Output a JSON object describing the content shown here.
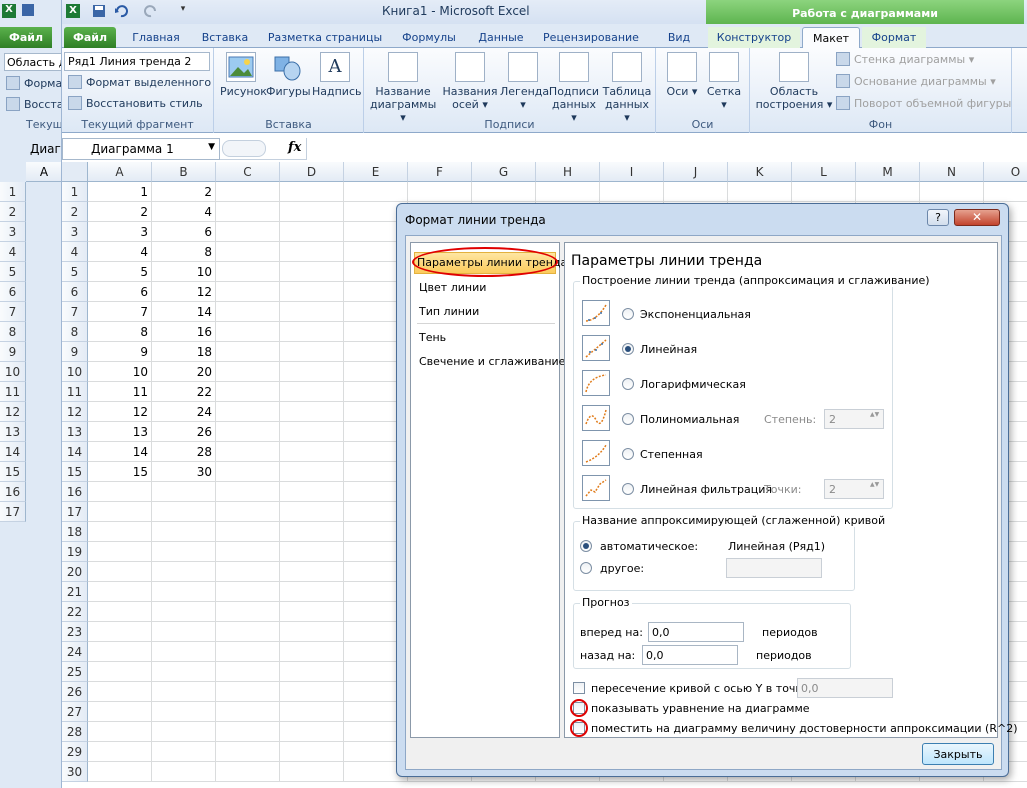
{
  "back_window": {
    "file_tab": "Файл",
    "namebox_frag": "Область д",
    "format_frag": "Форма",
    "restore_frag": "Восста",
    "current_frag": "Текущ",
    "namebox2_frag": "Диагр",
    "col_a": "A",
    "rows": [
      "1",
      "2",
      "3",
      "4",
      "5",
      "6",
      "7",
      "8",
      "9",
      "10",
      "11",
      "12",
      "13",
      "14",
      "15",
      "16",
      "17"
    ]
  },
  "window": {
    "title": "Книга1  -  Microsoft Excel",
    "context_band": "Работа с диаграммами"
  },
  "tabs": [
    "Файл",
    "Главная",
    "Вставка",
    "Разметка страницы",
    "Формулы",
    "Данные",
    "Рецензирование",
    "Вид",
    "Конструктор",
    "Макет",
    "Формат"
  ],
  "ribbon": {
    "current_fragment": {
      "selector_value": "Ряд1 Линия тренда 2",
      "format_selection": "Формат выделенного",
      "reset_style": "Восстановить стиль",
      "label": "Текущий фрагмент"
    },
    "insert": {
      "picture": "Рисунок",
      "shapes": "Фигуры",
      "textbox": "Надпись",
      "label": "Вставка"
    },
    "labels_group": {
      "chart_title": "Название диаграммы",
      "axis_titles": "Названия осей",
      "legend": "Легенда",
      "data_labels": "Подписи данных",
      "data_table": "Таблица данных",
      "label": "Подписи"
    },
    "axes_group": {
      "axes": "Оси",
      "gridlines": "Сетка",
      "label": "Оси"
    },
    "background": {
      "plot_area": "Область построения",
      "chart_wall": "Стенка диаграммы",
      "chart_floor": "Основание диаграммы",
      "rotation_3d": "Поворот объемной фигуры",
      "label": "Фон"
    }
  },
  "formula_bar": {
    "name_box": "Диаграмма 1",
    "fx": "fx"
  },
  "sheet": {
    "columns": [
      "A",
      "B",
      "C",
      "D",
      "E",
      "F",
      "G",
      "H",
      "I",
      "J",
      "K",
      "L",
      "M",
      "N",
      "O"
    ],
    "rows": [
      "1",
      "2",
      "3",
      "4",
      "5",
      "6",
      "7",
      "8",
      "9",
      "10",
      "11",
      "12",
      "13",
      "14",
      "15",
      "16",
      "17",
      "18",
      "19",
      "20",
      "21",
      "22",
      "23",
      "24",
      "25",
      "26",
      "27",
      "28",
      "29",
      "30"
    ],
    "col_b_values": [
      "2",
      "4",
      "6",
      "8",
      "10",
      "12",
      "14",
      "16",
      "18",
      "20",
      "22",
      "24",
      "26",
      "28",
      "30"
    ]
  },
  "dialog": {
    "title": "Формат линии тренда",
    "help": "?",
    "nav": [
      "Параметры линии тренда",
      "Цвет линии",
      "Тип линии",
      "Тень",
      "Свечение и сглаживание"
    ],
    "panel_title": "Параметры линии тренда",
    "trend_group_label": "Построение линии тренда (аппроксимация и сглаживание)",
    "trend_types": [
      "Экспоненциальная",
      "Линейная",
      "Логарифмическая",
      "Полиномиальная",
      "Степенная",
      "Линейная фильтрация"
    ],
    "degree_label": "Степень:",
    "degree_value": "2",
    "points_label": "Точки:",
    "points_value": "2",
    "name_group_label": "Название аппроксимирующей (сглаженной) кривой",
    "name_auto": "автоматическое:",
    "name_auto_value": "Линейная (Ряд1)",
    "name_custom": "другое:",
    "forecast_label": "Прогноз",
    "forward_label": "вперед на:",
    "forward_value": "0,0",
    "backward_label": "назад на:",
    "backward_value": "0,0",
    "periods": "периодов",
    "intercept_label": "пересечение кривой с осью Y в точке:",
    "intercept_value": "0,0",
    "show_equation": "показывать уравнение на диаграмме",
    "show_r2": "поместить на диаграмму величину достоверности аппроксимации (R^2)",
    "close_button": "Закрыть"
  }
}
